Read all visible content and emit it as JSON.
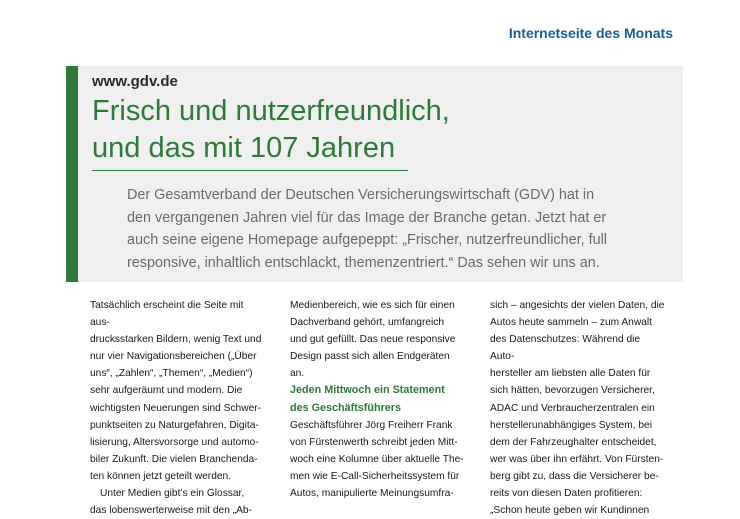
{
  "section_label": "Internetseite des Monats",
  "url": "www.gdv.de",
  "headline": [
    "Frisch und nutzerfreundlich,",
    "und das mit 107 Jahren"
  ],
  "lead": [
    "Der Gesamtverband der Deutschen Versicherungswirtschaft (GDV) hat in",
    "den vergangenen Jahren viel für das Image der Branche getan. Jetzt hat er",
    "auch seine eigene Homepage aufgepeppt: „Frischer, nutzerfreundlicher, full",
    "responsive, inhaltlich entschlackt, themenzentriert.“ Das sehen wir uns an."
  ],
  "col1": {
    "para1": [
      "Tatsächlich erscheint die Seite mit aus-",
      "drucksstarken Bildern, wenig Text und",
      "nur vier Navigationsbereichen („Über",
      "uns“, „Zahlen“, „Themen“, „Medien“)",
      "sehr aufgeräumt und modern. Die",
      "wichtigsten Neuerungen sind Schwer-",
      "punktseiten zu Naturgefahren, Digita-",
      "lisierung, Altersvorsorge und automo-",
      "biler Zukunft. Die vielen Branchenda-",
      "ten können jetzt geteilt werden."
    ],
    "para2": [
      "Unter Medien gibt’s ein Glossar,",
      "das lobenswerterweise mit den „Ab-"
    ]
  },
  "col2": {
    "para1": [
      "Medienbereich, wie es sich für einen",
      "Dachverband gehört, umfangreich",
      "und gut gefüllt. Das neue responsive",
      "Design passt sich allen Endgeräten",
      "an."
    ],
    "subhead": [
      "Jeden Mittwoch ein Statement",
      "des Geschäftsführers"
    ],
    "para2": [
      "Geschäftsführer Jörg Freiherr Frank",
      "von Fürstenwerth schreibt jeden Mitt-",
      "woch eine Kolumne über aktuelle The-",
      "men wie E-Call-Sicherheitssystem für",
      "Autos, manipulierte Meinungsumfra-"
    ]
  },
  "col3": {
    "para1": [
      "sich – angesichts der vielen Daten, die",
      "Autos heute sammeln – zum Anwalt",
      "des Datenschutzes: Während die Auto-",
      "hersteller am liebsten alle Daten für",
      "sich hätten, bevorzugen Versicherer,",
      "ADAC und Verbraucherzentralen ein",
      "herstellerunabhängiges System, bei",
      "dem der Fahrzeughalter entscheidet,",
      "wer was über ihn erfährt. Von Fürsten-",
      "berg gibt zu, dass die Versicherer be-",
      "reits von diesen Daten profitieren:",
      "„Schon heute geben wir Kundinnen"
    ]
  }
}
